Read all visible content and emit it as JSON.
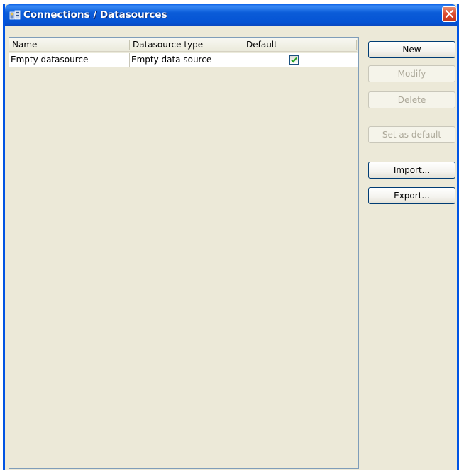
{
  "window": {
    "title": "Connections / Datasources"
  },
  "table": {
    "columns": [
      "Name",
      "Datasource type",
      "Default"
    ],
    "rows": [
      {
        "name": "Empty datasource",
        "type": "Empty data source",
        "default": true
      }
    ]
  },
  "buttons": {
    "new": "New",
    "modify": "Modify",
    "delete": "Delete",
    "set_default": "Set as default",
    "import": "Import...",
    "export": "Export..."
  },
  "colors": {
    "titlebar": "#0054e3",
    "background": "#ece9d8",
    "close": "#d9472b",
    "check": "#21a121"
  }
}
